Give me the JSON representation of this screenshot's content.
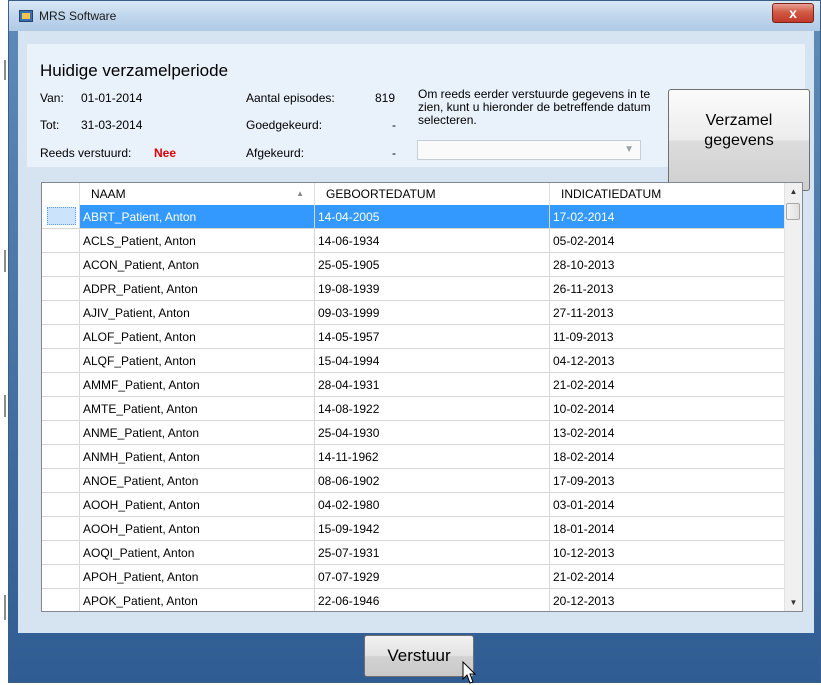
{
  "window": {
    "title": "MRS Software",
    "close_label": "x"
  },
  "period": {
    "heading": "Huidige verzamelperiode",
    "from_label": "Van:",
    "from_value": "01-01-2014",
    "to_label": "Tot:",
    "to_value": "31-03-2014",
    "sent_label": "Reeds verstuurd:",
    "sent_value": "Nee",
    "episodes_label": "Aantal episodes:",
    "episodes_value": "819",
    "approved_label": "Goedgekeurd:",
    "approved_value": "-",
    "rejected_label": "Afgekeurd:",
    "rejected_value": "-"
  },
  "info_text": "Om reeds eerder verstuurde gegevens in te zien, kunt u hieronder de betreffende datum selecteren.",
  "date_select": {
    "value": ""
  },
  "gather_button": {
    "line1": "Verzamel",
    "line2": "gegevens"
  },
  "grid": {
    "columns": [
      "NAAM",
      "GEBOORTEDATUM",
      "INDICATIEDATUM"
    ],
    "rows": [
      [
        "ABRT_Patient, Anton",
        "14-04-2005",
        "17-02-2014"
      ],
      [
        "ACLS_Patient, Anton",
        "14-06-1934",
        "05-02-2014"
      ],
      [
        "ACON_Patient, Anton",
        "25-05-1905",
        "28-10-2013"
      ],
      [
        "ADPR_Patient, Anton",
        "19-08-1939",
        "26-11-2013"
      ],
      [
        "AJIV_Patient, Anton",
        "09-03-1999",
        "27-11-2013"
      ],
      [
        "ALOF_Patient, Anton",
        "14-05-1957",
        "11-09-2013"
      ],
      [
        "ALQF_Patient, Anton",
        "15-04-1994",
        "04-12-2013"
      ],
      [
        "AMMF_Patient, Anton",
        "28-04-1931",
        "21-02-2014"
      ],
      [
        "AMTE_Patient, Anton",
        "14-08-1922",
        "10-02-2014"
      ],
      [
        "ANME_Patient, Anton",
        "25-04-1930",
        "13-02-2014"
      ],
      [
        "ANMH_Patient, Anton",
        "14-11-1962",
        "18-02-2014"
      ],
      [
        "ANOE_Patient, Anton",
        "08-06-1902",
        "17-09-2013"
      ],
      [
        "AOOH_Patient, Anton",
        "04-02-1980",
        "03-01-2014"
      ],
      [
        "AOOH_Patient, Anton",
        "15-09-1942",
        "18-01-2014"
      ],
      [
        "AOQI_Patient, Anton",
        "25-07-1931",
        "10-12-2013"
      ],
      [
        "APOH_Patient, Anton",
        "07-07-1929",
        "21-02-2014"
      ],
      [
        "APOK_Patient, Anton",
        "22-06-1946",
        "20-12-2013"
      ]
    ]
  },
  "send_button": "Verstuur"
}
